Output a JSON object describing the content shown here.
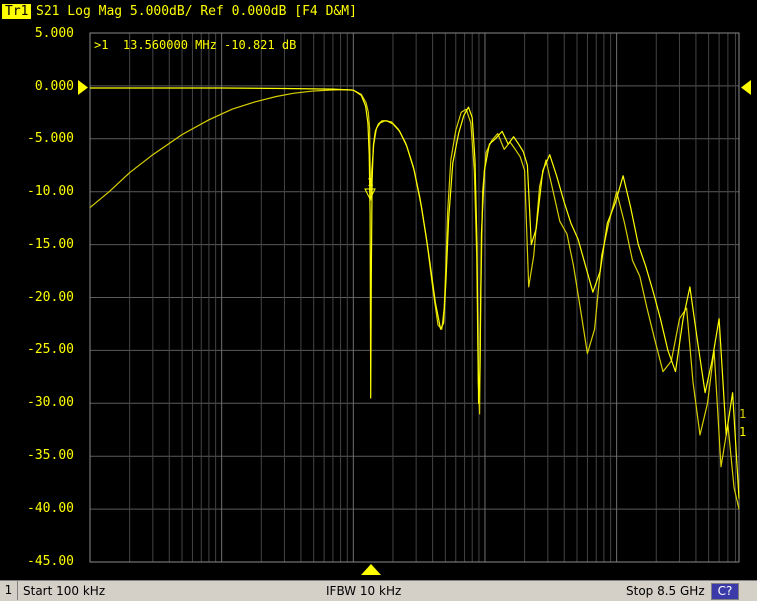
{
  "header": {
    "trace_badge": "Tr1",
    "text": "S21 Log Mag 5.000dB/ Ref 0.000dB [F4 D&M]"
  },
  "y_axis": {
    "ticks": [
      "5.000",
      "0.000",
      "-5.000",
      "-10.00",
      "-15.00",
      "-20.00",
      "-25.00",
      "-30.00",
      "-35.00",
      "-40.00",
      "-45.00"
    ]
  },
  "marker": {
    "readout": ">1  13.560000 MHz -10.821 dB",
    "label": "1"
  },
  "trace_labels": [
    "1",
    "1"
  ],
  "footer": {
    "channel": "1",
    "start": "Start 100 kHz",
    "ifbw": "IFBW 10 kHz",
    "stop": "Stop 8.5 GHz",
    "cal": "C?"
  },
  "colors": {
    "trace": "#ffff00",
    "grid": "#5a5a5a",
    "background": "#000000",
    "footer_bg": "#d4d0c8"
  },
  "chart_data": {
    "type": "line",
    "x_scale": "log",
    "x_unit": "Hz",
    "xlim": [
      100000,
      8500000000
    ],
    "ylim": [
      -45,
      5
    ],
    "ylabel": "",
    "series": [
      {
        "x": [
          100000,
          140000,
          200000,
          300000,
          500000,
          800000,
          1200000,
          1800000,
          2600000,
          3500000,
          4800000,
          6500000,
          8500000,
          10000000,
          11500000,
          12500000,
          13000000,
          13300000,
          13560000,
          13800000,
          14300000,
          15000000,
          16000000,
          17500000,
          19500000,
          22000000,
          25000000,
          28500000,
          32000000,
          36000000,
          40000000,
          44000000,
          47000000,
          49000000,
          50500000,
          52000000,
          55000000,
          60000000,
          66000000,
          72000000,
          78000000,
          83000000,
          86500000,
          89000000,
          91000000,
          93000000,
          96000000,
          102000000,
          112000000,
          125000000,
          140000000,
          155000000,
          170000000,
          185000000,
          200000000,
          215000000,
          235000000,
          260000000,
          290000000,
          330000000,
          370000000,
          420000000,
          470000000,
          530000000,
          600000000,
          680000000,
          770000000,
          870000000,
          1000000000,
          1150000000,
          1320000000,
          1500000000,
          1700000000,
          1950000000,
          2250000000,
          2600000000,
          3000000000,
          3400000000,
          3800000000,
          4300000000,
          4900000000,
          5500000000,
          6200000000,
          7000000000,
          7800000000,
          8500000000
        ],
        "y": [
          -11.5,
          -10.0,
          -8.2,
          -6.5,
          -4.6,
          -3.2,
          -2.2,
          -1.5,
          -1.0,
          -0.7,
          -0.5,
          -0.4,
          -0.35,
          -0.4,
          -0.8,
          -1.6,
          -2.5,
          -4.0,
          -10.8,
          -8.0,
          -5.5,
          -4.0,
          -3.5,
          -3.3,
          -3.4,
          -4.1,
          -5.4,
          -7.6,
          -10.5,
          -14.5,
          -19.0,
          -22.6,
          -23.0,
          -21.0,
          -17.0,
          -12.0,
          -7.0,
          -4.2,
          -2.5,
          -2.2,
          -3.5,
          -8.0,
          -16.0,
          -28.0,
          -31.0,
          -20.0,
          -10.0,
          -6.3,
          -5.2,
          -4.5,
          -6.0,
          -5.3,
          -6.0,
          -6.7,
          -8.0,
          -19.0,
          -16.0,
          -9.5,
          -7.0,
          -10.0,
          -12.8,
          -14.0,
          -17.0,
          -21.0,
          -25.3,
          -23.0,
          -16.0,
          -13.0,
          -10.0,
          -13.0,
          -16.5,
          -18.0,
          -21.0,
          -24.0,
          -27.0,
          -26.0,
          -22.0,
          -21.0,
          -28.0,
          -33.0,
          -30.0,
          -25.0,
          -36.0,
          -32.0,
          -38.0,
          -40.0
        ]
      },
      {
        "x": [
          100000,
          300000,
          1000000,
          3000000,
          7000000,
          10000000,
          11500000,
          12400000,
          12900000,
          13200000,
          13400000,
          13560000,
          13700000,
          13900000,
          14200000,
          14700000,
          15500000,
          16500000,
          18000000,
          20000000,
          22500000,
          25500000,
          29000000,
          33000000,
          37500000,
          42000000,
          46000000,
          48500000,
          50500000,
          53000000,
          57000000,
          63000000,
          69000000,
          75000000,
          80000000,
          84000000,
          87000000,
          89500000,
          91500000,
          94000000,
          99000000,
          108000000,
          120000000,
          135000000,
          150000000,
          165000000,
          180000000,
          195000000,
          210000000,
          225000000,
          245000000,
          275000000,
          310000000,
          350000000,
          400000000,
          450000000,
          510000000,
          580000000,
          660000000,
          750000000,
          850000000,
          980000000,
          1120000000,
          1280000000,
          1460000000,
          1660000000,
          1900000000,
          2150000000,
          2450000000,
          2800000000,
          3200000000,
          3600000000,
          4100000000,
          4700000000,
          5300000000,
          6000000000,
          6800000000,
          7600000000,
          8500000000
        ],
        "y": [
          -0.2,
          -0.2,
          -0.2,
          -0.25,
          -0.3,
          -0.4,
          -0.9,
          -1.9,
          -3.5,
          -6.5,
          -12.0,
          -29.5,
          -18.0,
          -9.0,
          -5.6,
          -4.3,
          -3.6,
          -3.3,
          -3.3,
          -3.6,
          -4.3,
          -5.7,
          -8.0,
          -11.5,
          -16.0,
          -20.5,
          -23.0,
          -22.4,
          -18.5,
          -12.5,
          -7.3,
          -4.5,
          -2.8,
          -2.0,
          -3.0,
          -7.0,
          -15.0,
          -30.0,
          -27.0,
          -14.0,
          -8.0,
          -5.5,
          -5.0,
          -4.3,
          -5.5,
          -4.8,
          -5.5,
          -6.2,
          -7.5,
          -15.0,
          -13.5,
          -8.0,
          -6.5,
          -8.5,
          -11.0,
          -13.0,
          -14.5,
          -17.0,
          -19.5,
          -17.5,
          -13.0,
          -11.0,
          -8.5,
          -11.5,
          -15.0,
          -17.0,
          -19.5,
          -22.0,
          -25.0,
          -27.0,
          -22.0,
          -19.0,
          -24.0,
          -29.0,
          -26.0,
          -22.0,
          -33.0,
          -29.0,
          -39.0
        ]
      }
    ]
  }
}
